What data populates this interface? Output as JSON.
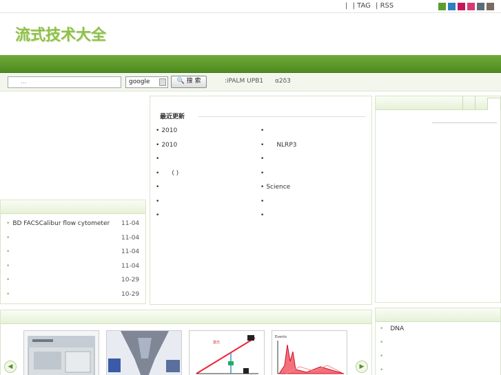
{
  "topbar": {
    "links": [
      "|",
      "| TAG",
      "| RSS"
    ],
    "swatches": [
      "#5b9e2f",
      "#2f7fc1",
      "#c2185b",
      "#d63a74",
      "#5a6d78",
      "#7a6a60"
    ]
  },
  "logo": {
    "text": "流式技术大全"
  },
  "search": {
    "input_value": "...",
    "engine": "google",
    "button_label": "🔍 搜 索",
    "hotwords": [
      ":iPALM UPB1",
      "α2δ3"
    ]
  },
  "left_list": {
    "rows": [
      {
        "title": "BD FACSCalibur flow cytometer",
        "date": "11-04"
      },
      {
        "title": "",
        "date": "11-04"
      },
      {
        "title": "",
        "date": "11-04"
      },
      {
        "title": "",
        "date": "11-04"
      },
      {
        "title": "",
        "date": "10-29"
      },
      {
        "title": "",
        "date": "10-29"
      }
    ]
  },
  "center": {
    "title": "最近更新",
    "left_items": [
      "2010",
      "2010",
      "",
      "( )",
      "",
      "",
      ""
    ],
    "right_items": [
      "",
      "NLRP3",
      "",
      "",
      "Science",
      "",
      ""
    ]
  },
  "right_bottom": {
    "items": [
      "DNA",
      "",
      "",
      ""
    ]
  },
  "carousel": {
    "prev": "◀",
    "next": "▶",
    "thumbs": [
      "flow-cytometer-photo",
      "cell-sorter-nozzle-photo",
      "optical-path-diagram",
      "3d-histogram-plot"
    ]
  }
}
